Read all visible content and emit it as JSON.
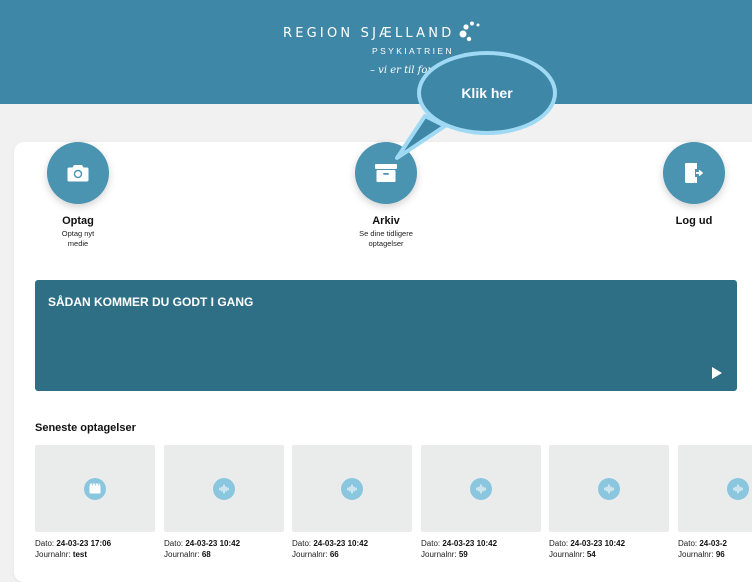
{
  "header": {
    "brand_name": "REGION SJÆLLAND",
    "brand_sub": "PSYKIATRIEN",
    "brand_tagline": "– vi er til for dig"
  },
  "callout": {
    "text": "Klik her"
  },
  "actions": [
    {
      "title": "Optag",
      "subtitle_line1": "Optag nyt",
      "subtitle_line2": "medie",
      "icon": "camera-icon"
    },
    {
      "title": "Arkiv",
      "subtitle_line1": "Se dine tidligere",
      "subtitle_line2": "optagelser",
      "icon": "archive-box-icon"
    },
    {
      "title": "Log ud",
      "subtitle_line1": "",
      "subtitle_line2": "",
      "icon": "logout-door-icon"
    }
  ],
  "video": {
    "title": "SÅDAN KOMMER DU GODT I GANG"
  },
  "recent": {
    "title": "Seneste optagelser",
    "date_label": "Dato:",
    "journal_label": "Journalnr:",
    "items": [
      {
        "date": "24-03-23 17:06",
        "journal": "test",
        "type": "video"
      },
      {
        "date": "24-03-23 10:42",
        "journal": "68",
        "type": "audio"
      },
      {
        "date": "24-03-23 10:42",
        "journal": "66",
        "type": "audio"
      },
      {
        "date": "24-03-23 10:42",
        "journal": "59",
        "type": "audio"
      },
      {
        "date": "24-03-23 10:42",
        "journal": "54",
        "type": "audio"
      },
      {
        "date": "24-03-2",
        "journal": "96",
        "type": "audio"
      }
    ]
  },
  "colors": {
    "header": "#3f87a6",
    "button": "#4a93b1",
    "video_banner": "#2f6f86",
    "callout_border": "#9fd9f4",
    "thumb_icon": "#8bc6df"
  }
}
